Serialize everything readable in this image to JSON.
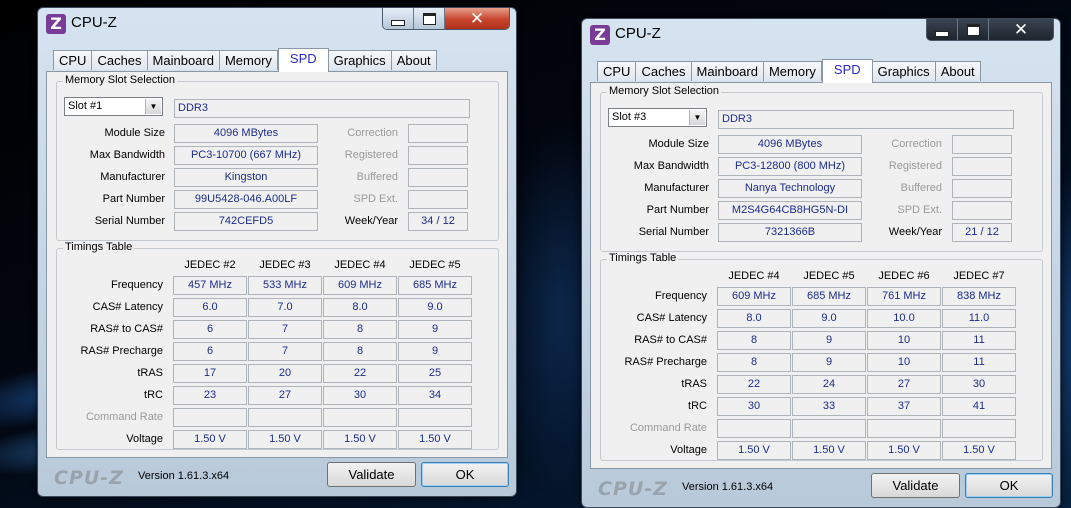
{
  "windows": [
    {
      "title": "CPU-Z",
      "app_icon": "Z",
      "tabs": [
        {
          "label": "CPU"
        },
        {
          "label": "Caches"
        },
        {
          "label": "Mainboard"
        },
        {
          "label": "Memory"
        },
        {
          "label": "SPD",
          "active": true
        },
        {
          "label": "Graphics"
        },
        {
          "label": "About"
        }
      ],
      "slot_group_title": "Memory Slot Selection",
      "slot_selected": "Slot #1",
      "memory_type": "DDR3",
      "module_size_label": "Module Size",
      "module_size": "4096 MBytes",
      "max_bandwidth_label": "Max Bandwidth",
      "max_bandwidth": "PC3-10700 (667 MHz)",
      "manufacturer_label": "Manufacturer",
      "manufacturer": "Kingston",
      "part_number_label": "Part Number",
      "part_number": "99U5428-046.A00LF",
      "serial_number_label": "Serial Number",
      "serial_number": "742CEFD5",
      "correction_label": "Correction",
      "registered_label": "Registered",
      "buffered_label": "Buffered",
      "spd_ext_label": "SPD Ext.",
      "week_year_label": "Week/Year",
      "week_year": "34 / 12",
      "timings_group_title": "Timings Table",
      "timing_columns": [
        "JEDEC #2",
        "JEDEC #3",
        "JEDEC #4",
        "JEDEC #5"
      ],
      "timing_rows": [
        {
          "label": "Frequency",
          "values": [
            "457 MHz",
            "533 MHz",
            "609 MHz",
            "685 MHz"
          ]
        },
        {
          "label": "CAS# Latency",
          "values": [
            "6.0",
            "7.0",
            "8.0",
            "9.0"
          ]
        },
        {
          "label": "RAS# to CAS#",
          "values": [
            "6",
            "7",
            "8",
            "9"
          ]
        },
        {
          "label": "RAS# Precharge",
          "values": [
            "6",
            "7",
            "8",
            "9"
          ]
        },
        {
          "label": "tRAS",
          "values": [
            "17",
            "20",
            "22",
            "25"
          ]
        },
        {
          "label": "tRC",
          "values": [
            "23",
            "27",
            "30",
            "34"
          ]
        },
        {
          "label": "Command Rate",
          "values": [
            "",
            "",
            "",
            ""
          ],
          "dim": true
        },
        {
          "label": "Voltage",
          "values": [
            "1.50 V",
            "1.50 V",
            "1.50 V",
            "1.50 V"
          ]
        }
      ],
      "logo": "CPU-Z",
      "version": "Version 1.61.3.x64",
      "validate_label": "Validate",
      "ok_label": "OK"
    },
    {
      "title": "CPU-Z",
      "app_icon": "Z",
      "tabs": [
        {
          "label": "CPU"
        },
        {
          "label": "Caches"
        },
        {
          "label": "Mainboard"
        },
        {
          "label": "Memory"
        },
        {
          "label": "SPD",
          "active": true
        },
        {
          "label": "Graphics"
        },
        {
          "label": "About"
        }
      ],
      "slot_group_title": "Memory Slot Selection",
      "slot_selected": "Slot #3",
      "memory_type": "DDR3",
      "module_size_label": "Module Size",
      "module_size": "4096 MBytes",
      "max_bandwidth_label": "Max Bandwidth",
      "max_bandwidth": "PC3-12800 (800 MHz)",
      "manufacturer_label": "Manufacturer",
      "manufacturer": "Nanya Technology",
      "part_number_label": "Part Number",
      "part_number": "M2S4G64CB8HG5N-DI",
      "serial_number_label": "Serial Number",
      "serial_number": "7321366B",
      "correction_label": "Correction",
      "registered_label": "Registered",
      "buffered_label": "Buffered",
      "spd_ext_label": "SPD Ext.",
      "week_year_label": "Week/Year",
      "week_year": "21 / 12",
      "timings_group_title": "Timings Table",
      "timing_columns": [
        "JEDEC #4",
        "JEDEC #5",
        "JEDEC #6",
        "JEDEC #7"
      ],
      "timing_rows": [
        {
          "label": "Frequency",
          "values": [
            "609 MHz",
            "685 MHz",
            "761 MHz",
            "838 MHz"
          ]
        },
        {
          "label": "CAS# Latency",
          "values": [
            "8.0",
            "9.0",
            "10.0",
            "11.0"
          ]
        },
        {
          "label": "RAS# to CAS#",
          "values": [
            "8",
            "9",
            "10",
            "11"
          ]
        },
        {
          "label": "RAS# Precharge",
          "values": [
            "8",
            "9",
            "10",
            "11"
          ]
        },
        {
          "label": "tRAS",
          "values": [
            "22",
            "24",
            "27",
            "30"
          ]
        },
        {
          "label": "tRC",
          "values": [
            "30",
            "33",
            "37",
            "41"
          ]
        },
        {
          "label": "Command Rate",
          "values": [
            "",
            "",
            "",
            ""
          ],
          "dim": true
        },
        {
          "label": "Voltage",
          "values": [
            "1.50 V",
            "1.50 V",
            "1.50 V",
            "1.50 V"
          ]
        }
      ],
      "logo": "CPU-Z",
      "version": "Version 1.61.3.x64",
      "validate_label": "Validate",
      "ok_label": "OK"
    }
  ]
}
